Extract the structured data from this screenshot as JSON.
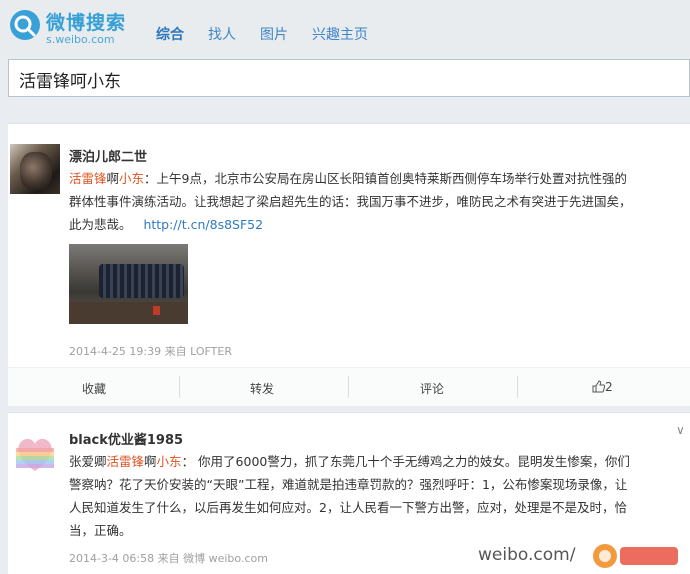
{
  "header": {
    "logo_title": "微博搜索",
    "logo_sub": "s.weibo.com",
    "tabs": [
      {
        "label": "综合",
        "active": true
      },
      {
        "label": "找人",
        "active": false
      },
      {
        "label": "图片",
        "active": false
      },
      {
        "label": "兴趣主页",
        "active": false
      }
    ]
  },
  "search": {
    "query": "活雷锋呵小东"
  },
  "posts": [
    {
      "username": "漂泊儿郎二世",
      "line1_pre": "活雷锋",
      "line1_mid": "啊",
      "line1_name": "小东",
      "line1_rest": "：上午9点，北京市公安局在房山区长阳镇首创奥特莱斯西侧停车场举行处置对抗性强的",
      "line2": "群体性事件演练活动。让我想起了梁启超先生的话：我国万事不进步，唯防民之术有突进于先进国矣，",
      "line3": "此为悲哉。",
      "link": "http://t.cn/8s8SF52",
      "meta": "2014-4-25 19:39 来自 LOFTER",
      "actions": {
        "collect": "收藏",
        "forward": "转发",
        "comment": "评论",
        "like_count": "2"
      }
    },
    {
      "username": "black优业酱1985",
      "line1_a": "张爱卿",
      "line1_b": "活雷锋",
      "line1_c": "啊",
      "line1_d": "小东",
      "line1_rest": "： 你用了6000警力，抓了东莞几十个手无缚鸡之力的妓女。昆明发生惨案，你们",
      "line2": "警察呐？花了天价安装的“天眼”工程，难道就是拍违章罚款的？强烈呼吁：1，公布惨案现场录像，让",
      "line3": "人民知道发生了什么，以后再发生如何应对。2，让人民看一下警方出警，应对，处理是不是及时，恰",
      "line4": "当，正确。",
      "meta": "2014-3-4 06:58 来自 微博 weibo.com"
    }
  ],
  "watermark": "weibo.com/",
  "colors": {
    "accent": "#2f7bc2",
    "highlight": "#e0531f"
  }
}
